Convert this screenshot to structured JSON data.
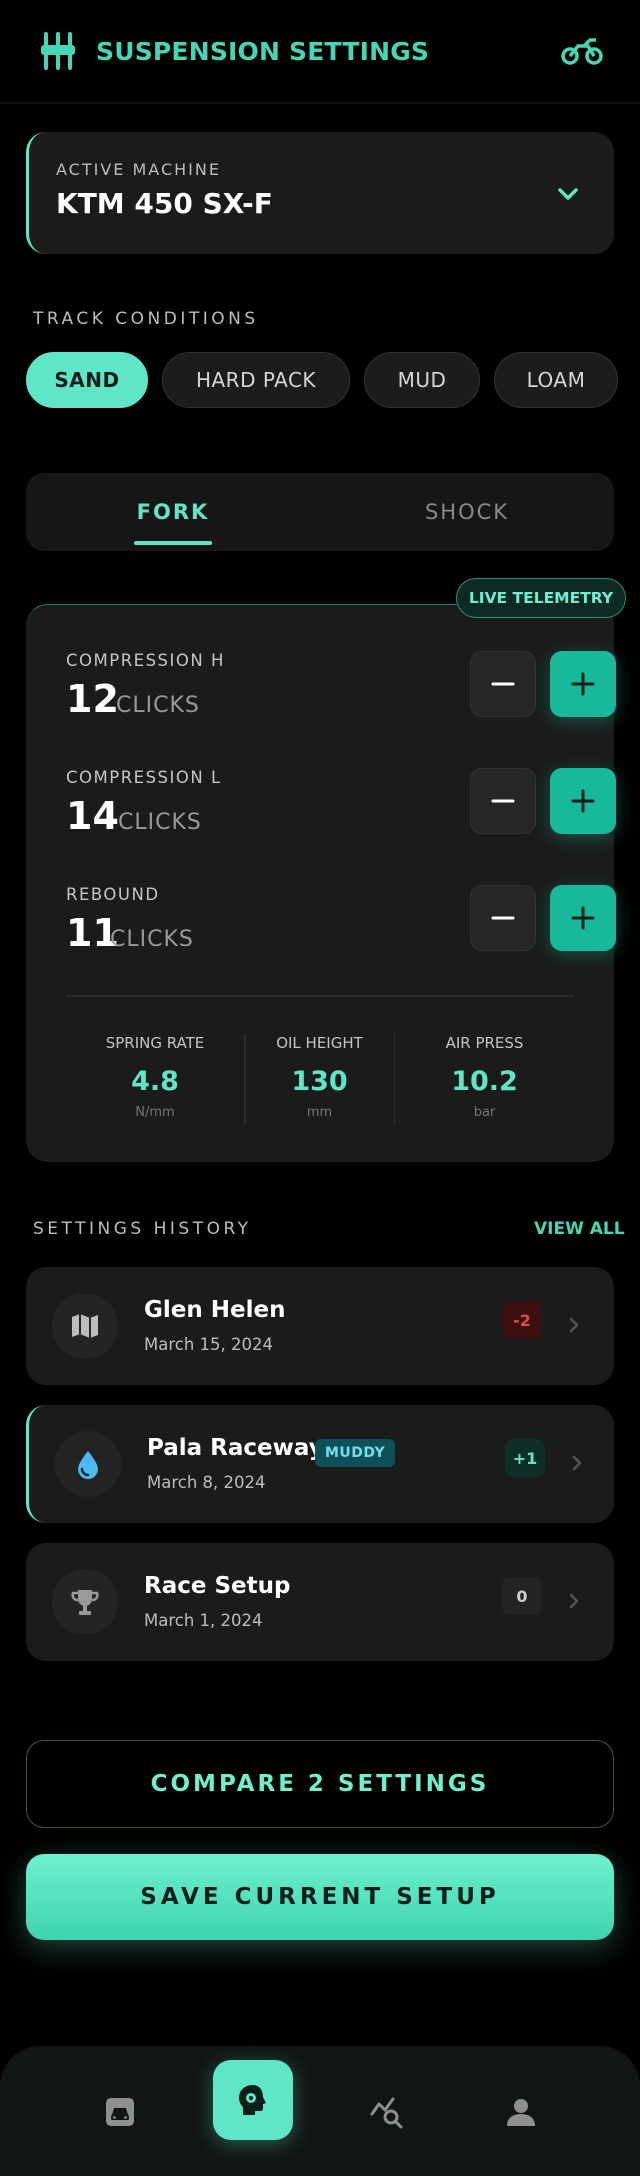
{
  "header": {
    "title": "SUSPENSION SETTINGS",
    "logo_icon": "suspension-sliders-icon",
    "action_icon": "motorcycle-icon"
  },
  "machine": {
    "label": "ACTIVE MACHINE",
    "value": "KTM 450 SX-F",
    "icon": "chevron-down-icon"
  },
  "conditions": {
    "label": "TRACK CONDITIONS",
    "chips": [
      {
        "label": "SAND",
        "active": true
      },
      {
        "label": "HARD PACK",
        "active": false
      },
      {
        "label": "MUD",
        "active": false
      },
      {
        "label": "LOAM",
        "active": false
      }
    ]
  },
  "tabs": [
    {
      "label": "FORK",
      "active": true
    },
    {
      "label": "SHOCK",
      "active": false
    }
  ],
  "panel": {
    "badge": "LIVE TELEMETRY",
    "rows": [
      {
        "name": "COMPRESSION H",
        "value": "12",
        "unit": "CLICKS"
      },
      {
        "name": "COMPRESSION L",
        "value": "14",
        "unit": "CLICKS"
      },
      {
        "name": "REBOUND",
        "value": "11",
        "unit": "CLICKS"
      }
    ],
    "stats": [
      {
        "label": "SPRING RATE",
        "value": "4.8",
        "unit": "N/mm"
      },
      {
        "label": "OIL HEIGHT",
        "value": "130",
        "unit": "mm"
      },
      {
        "label": "AIR PRESS",
        "value": "10.2",
        "unit": "bar"
      }
    ]
  },
  "history": {
    "label": "SETTINGS HISTORY",
    "view_all": "VIEW ALL",
    "items": [
      {
        "name": "Glen Helen",
        "date": "March 15, 2024",
        "delta": "-2",
        "icon": "map-icon",
        "tag": ""
      },
      {
        "name": "Pala Raceway",
        "date": "March 8, 2024",
        "delta": "+1",
        "icon": "water-drop-icon",
        "tag": "MUDDY"
      },
      {
        "name": "Race Setup",
        "date": "March 1, 2024",
        "delta": "0",
        "icon": "trophy-icon",
        "tag": ""
      }
    ]
  },
  "actions": {
    "compare": "COMPARE 2 SETTINGS",
    "save": "SAVE CURRENT SETUP"
  },
  "nav": {
    "icons": [
      "garage-icon",
      "settings-head-icon",
      "analytics-icon",
      "profile-icon"
    ]
  },
  "colors": {
    "accent": "#5fe6c6",
    "accent_dark": "#18b99a",
    "negative": "#e84a4a",
    "info": "#6ee0f0",
    "background": "#000000",
    "card": "#1b1b1b"
  }
}
